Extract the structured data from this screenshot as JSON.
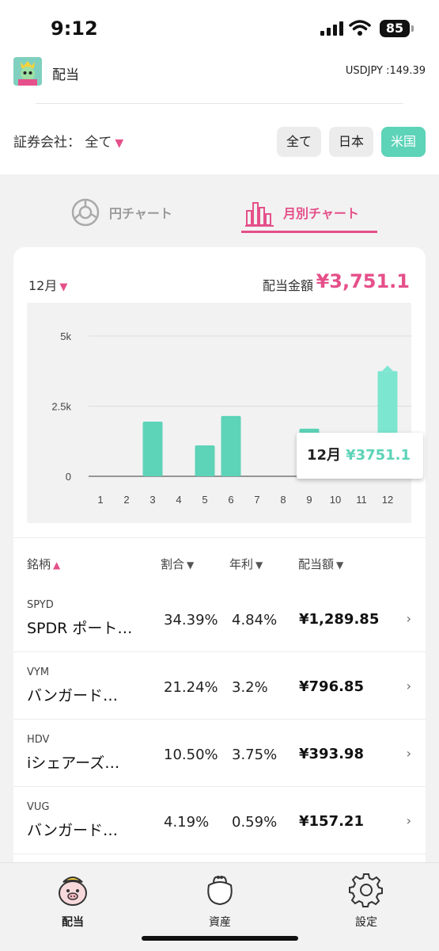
{
  "status_bar": {
    "time": "9:12",
    "battery": "85"
  },
  "header": {
    "title": "配当",
    "exchange_rate": "USDJPY :149.39"
  },
  "filter": {
    "broker_label": "証券会社：",
    "broker_value": "全て",
    "segments": [
      {
        "label": "全て",
        "active": false
      },
      {
        "label": "日本",
        "active": false
      },
      {
        "label": "米国",
        "active": true
      }
    ]
  },
  "tabs": [
    {
      "label": "円チャート",
      "active": false
    },
    {
      "label": "月別チャート",
      "active": true
    }
  ],
  "summary": {
    "month": "12月",
    "label": "配当金額",
    "value": "¥3,751.1"
  },
  "chart_data": {
    "type": "bar",
    "categories": [
      "1",
      "2",
      "3",
      "4",
      "5",
      "6",
      "7",
      "8",
      "9",
      "10",
      "11",
      "12"
    ],
    "values": [
      0,
      0,
      1950,
      0,
      1100,
      2150,
      0,
      0,
      1700,
      1500,
      0,
      3751.1
    ],
    "y_ticks": [
      {
        "value": 0,
        "label": "0"
      },
      {
        "value": 2500,
        "label": "2.5k"
      },
      {
        "value": 5000,
        "label": "5k"
      }
    ],
    "ylim": [
      0,
      5000
    ],
    "highlight_index": 11,
    "tooltip": {
      "month": "12月",
      "value": "¥3751.1"
    },
    "bar_color": "#5dd3b8",
    "highlight_color": "#7de6d0"
  },
  "table": {
    "headers": {
      "name": "銘柄",
      "ratio": "割合",
      "yield": "年利",
      "amount": "配当額"
    },
    "rows": [
      {
        "ticker": "SPYD",
        "name": "SPDR ポート…",
        "ratio": "34.39%",
        "yield": "4.84%",
        "amount": "¥1,289.85"
      },
      {
        "ticker": "VYM",
        "name": "バンガード…",
        "ratio": "21.24%",
        "yield": "3.2%",
        "amount": "¥796.85"
      },
      {
        "ticker": "HDV",
        "name": "iシェアーズ…",
        "ratio": "10.50%",
        "yield": "3.75%",
        "amount": "¥393.98"
      },
      {
        "ticker": "VUG",
        "name": "バンガード…",
        "ratio": "4.19%",
        "yield": "0.59%",
        "amount": "¥157.21"
      }
    ]
  },
  "bottom_nav": [
    {
      "label": "配当",
      "icon": "pig-icon",
      "active": true
    },
    {
      "label": "資産",
      "icon": "coin-purse-icon",
      "active": false
    },
    {
      "label": "設定",
      "icon": "gear-icon",
      "active": false
    }
  ],
  "colors": {
    "accent_pink": "#e5508a",
    "accent_mint": "#5dd3b8"
  }
}
